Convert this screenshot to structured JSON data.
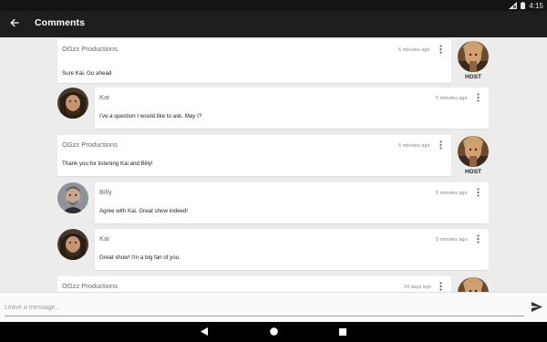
{
  "status_bar": {
    "time": "4:15"
  },
  "app_bar": {
    "title": "Comments"
  },
  "comments": [
    {
      "author": "OGzz Productions",
      "time": "5 minutes ago",
      "message": "Sure Kai. Go ahead",
      "badge": "HOST"
    },
    {
      "author": "Kai",
      "time": "5 minutes ago",
      "message": "I've a question I would like to ask. May I?"
    },
    {
      "author": "OGzz Productions",
      "time": "5 minutes ago",
      "message": "Thank you for listening Kai and Billy!",
      "badge": "HOST"
    },
    {
      "author": "Billy",
      "time": "5 minutes ago",
      "message": "Agree with Kai. Great show indeed!"
    },
    {
      "author": "Kai",
      "time": "5 minutes ago",
      "message": "Great show! I'm a big fan of you."
    },
    {
      "author": "OGzz Productions",
      "time": "24 days ago",
      "message": ""
    }
  ],
  "composer": {
    "placeholder": "Leave a message..."
  },
  "icons": {
    "back": "arrow-left-icon",
    "more": "more-vert-icon",
    "send": "send-icon",
    "nav_back": "nav-back-icon",
    "nav_home": "nav-home-icon",
    "nav_recents": "nav-recents-icon",
    "status": [
      "no-sim-icon",
      "battery-icon"
    ]
  },
  "colors": {
    "app_bar": "#1e1e1e",
    "background": "#ececec",
    "card": "#ffffff"
  }
}
